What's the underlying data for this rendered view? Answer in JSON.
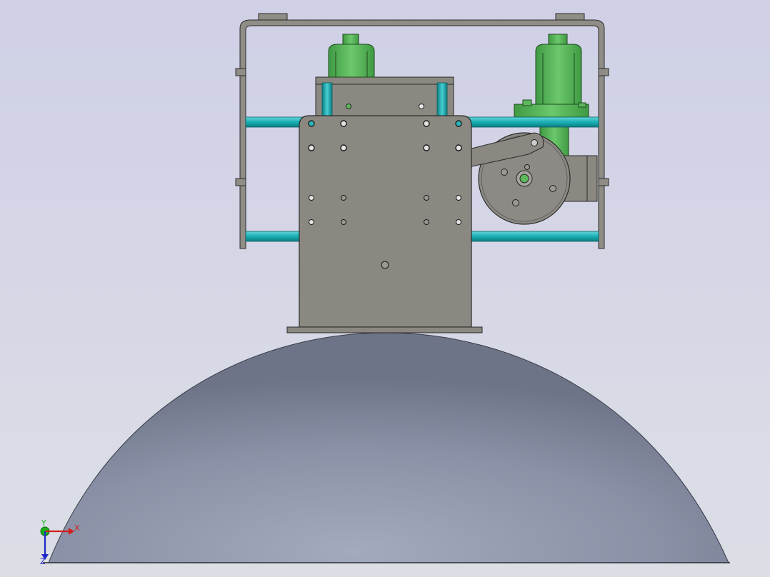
{
  "viewport": {
    "background_top": "#cfd0e6",
    "background_bottom": "#dcdee6"
  },
  "colors": {
    "dome": "#8c93a8",
    "plate": "#8a8880",
    "frame": "#8f8d86",
    "rod": "#1fb3b8",
    "motor": "#5cb85c",
    "outline": "#2a2a2a"
  },
  "triad": {
    "x_label": "X",
    "y_label": "Y",
    "z_label": "Z",
    "x_color": "#d21e1e",
    "y_color": "#19b419",
    "z_color": "#1e28c8"
  }
}
